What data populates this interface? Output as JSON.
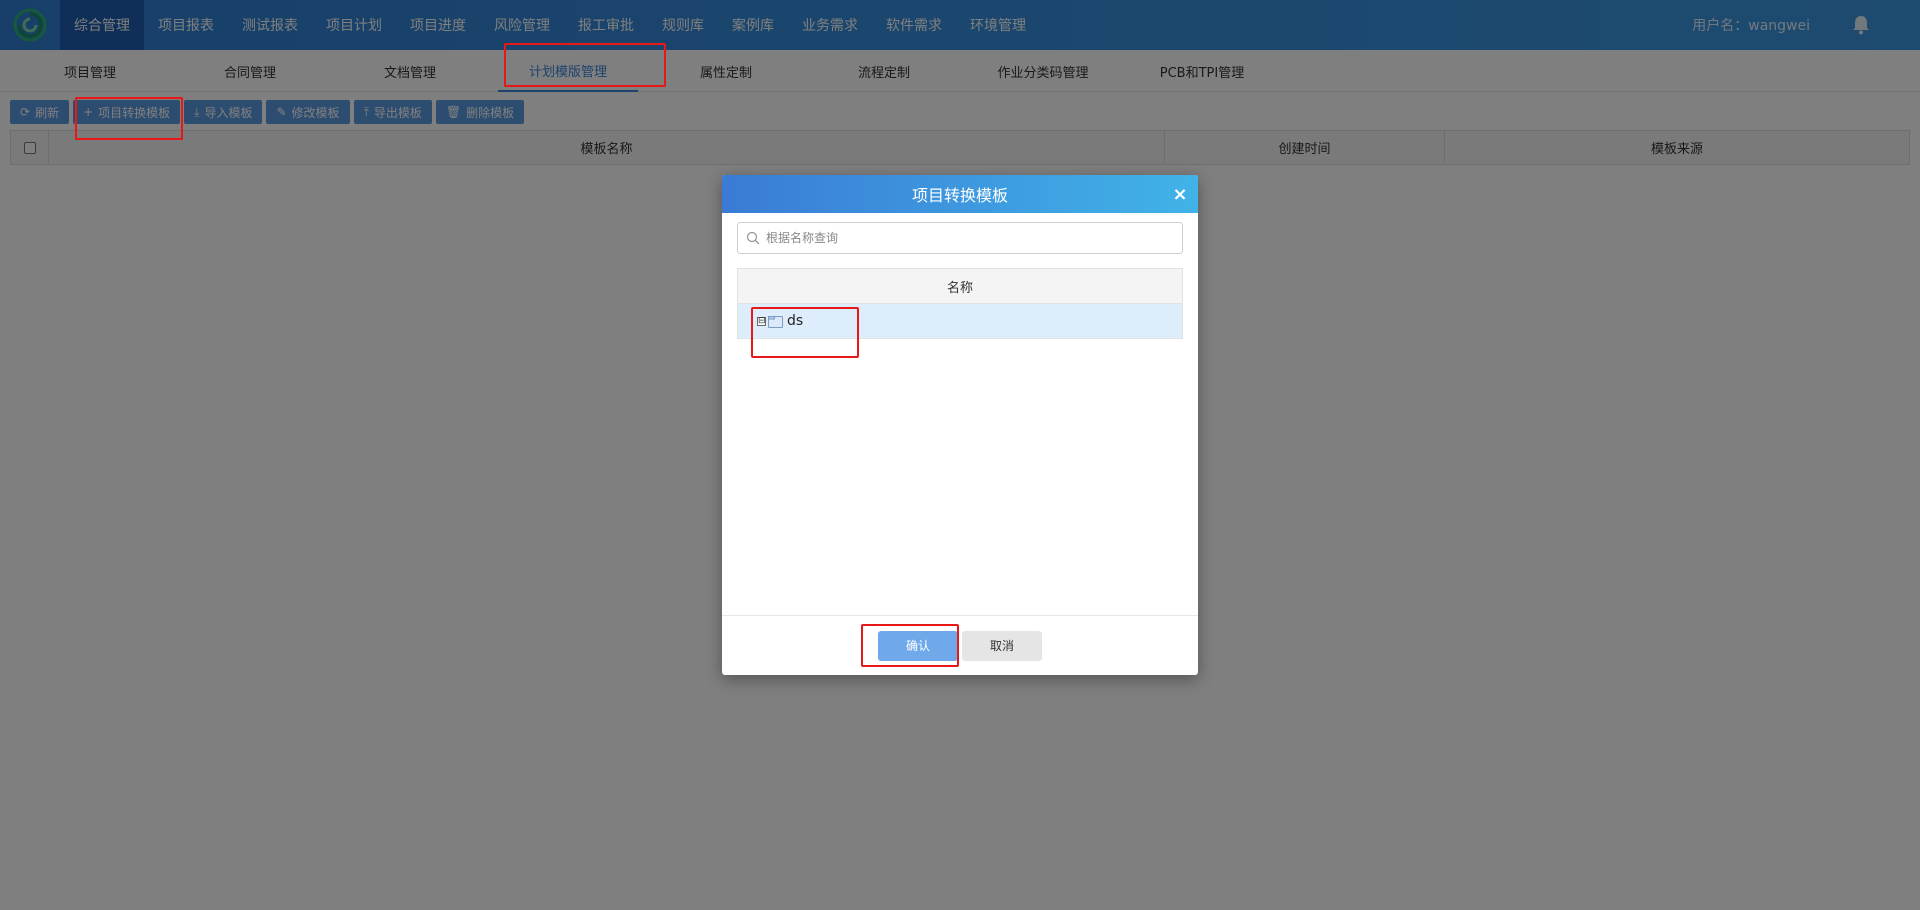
{
  "nav": {
    "items": [
      "综合管理",
      "项目报表",
      "测试报表",
      "项目计划",
      "项目进度",
      "风险管理",
      "报工审批",
      "规则库",
      "案例库",
      "业务需求",
      "软件需求",
      "环境管理"
    ],
    "active_index": 0,
    "user_label": "用户名：wangwei",
    "bell_icon": "bell-icon"
  },
  "subtabs": {
    "items": [
      "项目管理",
      "合同管理",
      "文档管理",
      "计划模版管理",
      "属性定制",
      "流程定制",
      "作业分类码管理",
      "PCB和TPI管理"
    ],
    "active_index": 3
  },
  "toolbar": {
    "buttons": [
      {
        "label": "刷新",
        "icon": "refresh-icon"
      },
      {
        "label": "项目转换模板",
        "icon": "plus-icon"
      },
      {
        "label": "导入模板",
        "icon": "import-icon"
      },
      {
        "label": "修改模板",
        "icon": "edit-icon"
      },
      {
        "label": "导出模板",
        "icon": "export-icon"
      },
      {
        "label": "删除模板",
        "icon": "trash-icon"
      }
    ]
  },
  "grid": {
    "columns": [
      "模板名称",
      "创建时间",
      "模板来源"
    ]
  },
  "dialog": {
    "title": "项目转换模板",
    "close_glyph": "×",
    "search_placeholder": "根据名称查询",
    "tree_header": "名称",
    "tree_items": [
      {
        "label": "ds",
        "expander": "⊟"
      }
    ],
    "confirm_label": "确认",
    "cancel_label": "取消"
  },
  "colors": {
    "nav_bg": "#3890dd",
    "nav_active": "#1f5fb3",
    "accent": "#3b87d8",
    "toolbar_btn": "#5b9be0",
    "highlight": "#e81818"
  }
}
